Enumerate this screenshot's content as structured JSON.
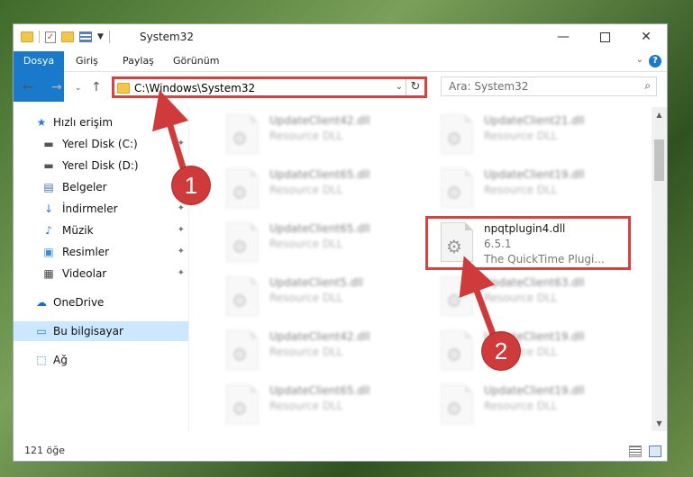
{
  "window": {
    "title": "System32",
    "controls": {
      "minimize": "—",
      "close": "✕"
    }
  },
  "ribbon": {
    "tabs": [
      "Dosya",
      "Giriş",
      "Paylaş",
      "Görünüm"
    ],
    "help": "?"
  },
  "nav": {
    "address": "C:\\Windows\\System32",
    "search_placeholder": "Ara: System32"
  },
  "sidebar": {
    "items": [
      {
        "label": "Hızlı erişim",
        "icon": "star-icon"
      },
      {
        "label": "Yerel Disk (C:)",
        "icon": "drive-icon"
      },
      {
        "label": "Yerel Disk (D:)",
        "icon": "drive-icon"
      },
      {
        "label": "Belgeler",
        "icon": "documents-icon"
      },
      {
        "label": "İndirmeler",
        "icon": "download-icon"
      },
      {
        "label": "Müzik",
        "icon": "music-icon"
      },
      {
        "label": "Resimler",
        "icon": "pictures-icon"
      },
      {
        "label": "Videolar",
        "icon": "videos-icon"
      },
      {
        "label": "OneDrive",
        "icon": "cloud-icon"
      },
      {
        "label": "Bu bilgisayar",
        "icon": "computer-icon"
      },
      {
        "label": "Ağ",
        "icon": "network-icon"
      }
    ]
  },
  "files": [
    {
      "name": "UpdateClient42.dll",
      "type": "Resource DLL"
    },
    {
      "name": "UpdateClient21.dll",
      "type": "Resource DLL"
    },
    {
      "name": "UpdateClient65.dll",
      "type": "Resource DLL"
    },
    {
      "name": "UpdateClient19.dll",
      "type": "Resource DLL"
    },
    {
      "name": "UpdateClient65.dll",
      "type": "Resource DLL"
    },
    {
      "name": "npqtplugin4.dll",
      "version": "6.5.1",
      "description": "The QuickTime Plugi..."
    },
    {
      "name": "UpdateClient5.dll",
      "type": "Resource DLL"
    },
    {
      "name": "UpdateClient63.dll",
      "type": "Resource DLL"
    },
    {
      "name": "UpdateClient42.dll",
      "type": "Resource DLL"
    },
    {
      "name": "UpdateClient19.dll",
      "type": "Resource DLL"
    },
    {
      "name": "UpdateClient65.dll",
      "type": "Resource DLL"
    },
    {
      "name": "UpdateClient19.dll",
      "type": "Resource DLL"
    }
  ],
  "status": {
    "count": "121 öğe"
  },
  "annotations": {
    "marker1": "1",
    "marker2": "2",
    "highlight_color": "#d94141"
  }
}
